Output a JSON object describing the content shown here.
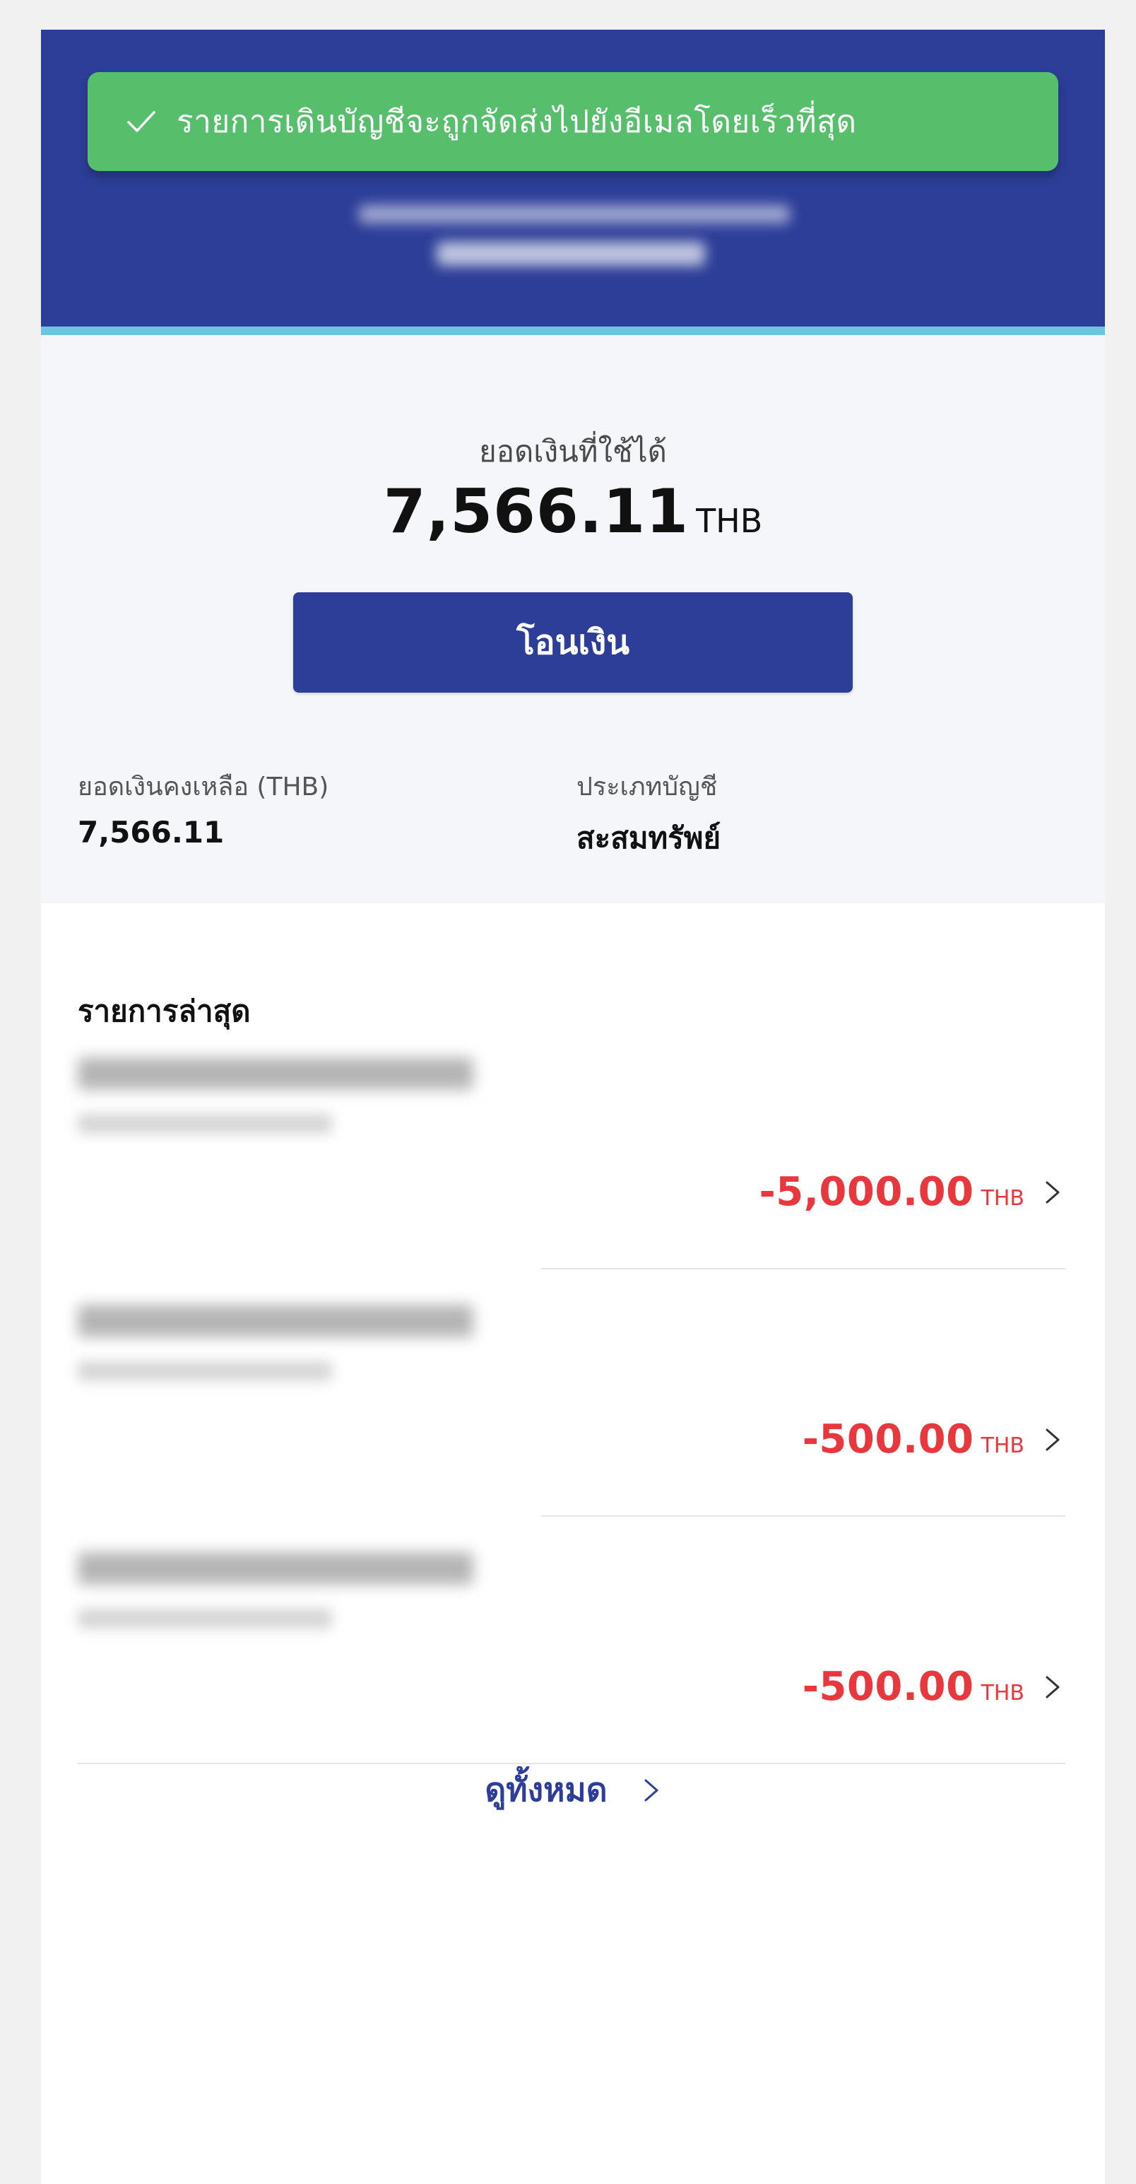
{
  "header": {
    "toast": {
      "icon": "check-icon",
      "message": "รายการเดินบัญชีจะถูกจัดส่งไปยังอีเมลโดยเร็วที่สุด"
    },
    "colors": {
      "header_bg": "#2d3e98",
      "stripe": "#6dc4de",
      "toast_bg": "#57bf6c"
    }
  },
  "balance": {
    "available_label": "ยอดเงินที่ใช้ได้",
    "available_amount": "7,566.11",
    "available_currency": "THB",
    "transfer_button_label": "โอนเงิน",
    "remaining_label": "ยอดเงินคงเหลือ (THB)",
    "remaining_value": "7,566.11",
    "account_type_label": "ประเภทบัญชี",
    "account_type_value": "สะสมทรัพย์"
  },
  "transactions": {
    "title": "รายการล่าสุด",
    "items": [
      {
        "amount": "-5,000.00",
        "currency": "THB"
      },
      {
        "amount": "-500.00",
        "currency": "THB"
      },
      {
        "amount": "-500.00",
        "currency": "THB"
      }
    ],
    "view_all_label": "ดูทั้งหมด",
    "colors": {
      "negative_amount": "#e8383d",
      "link": "#2d3e98"
    }
  }
}
